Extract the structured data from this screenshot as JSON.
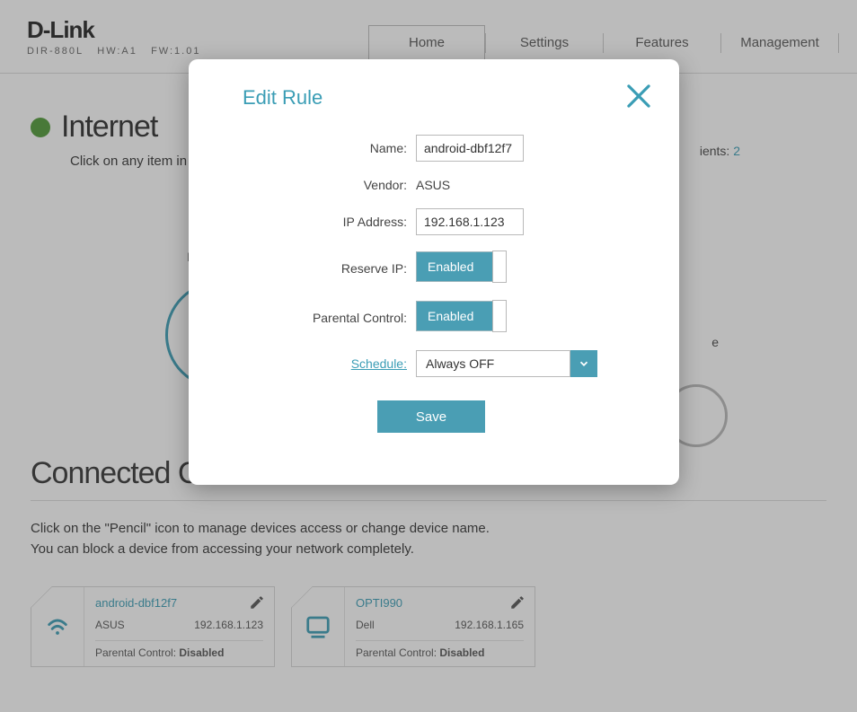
{
  "brand": "D-Link",
  "model_line": {
    "model": "DIR-880L",
    "hw": "HW:A1",
    "fw": "FW:1.01"
  },
  "nav": {
    "home": "Home",
    "settings": "Settings",
    "features": "Features",
    "management": "Management"
  },
  "status": {
    "title": "Internet",
    "desc_visible": "Click on any item in",
    "clients_label_visible": "ients:",
    "clients_count": "2",
    "topo_label_visible": "In",
    "topo_r_visible": "e"
  },
  "clients_section": {
    "title": "Connected Clients",
    "desc1": "Click on the \"Pencil\" icon to manage devices access or change device name.",
    "desc2": "You can block a device from accessing your network completely."
  },
  "clients": [
    {
      "name": "android-dbf12f7",
      "vendor": "ASUS",
      "ip": "192.168.1.123",
      "pc_label": "Parental Control:",
      "pc_value": "Disabled",
      "conn": "wifi"
    },
    {
      "name": "OPTI990",
      "vendor": "Dell",
      "ip": "192.168.1.165",
      "pc_label": "Parental Control:",
      "pc_value": "Disabled",
      "conn": "wired"
    }
  ],
  "modal": {
    "title": "Edit Rule",
    "labels": {
      "name": "Name:",
      "vendor": "Vendor:",
      "ip": "IP Address:",
      "reserve": "Reserve IP:",
      "parental": "Parental Control:",
      "schedule": "Schedule:"
    },
    "values": {
      "name": "android-dbf12f7",
      "vendor": "ASUS",
      "ip": "192.168.1.123",
      "reserve_state": "Enabled",
      "parental_state": "Enabled",
      "schedule": "Always OFF"
    },
    "save": "Save"
  },
  "colors": {
    "accent": "#3a9db5",
    "toggle": "#4a9eb4",
    "status_ok": "#4f9a36"
  }
}
